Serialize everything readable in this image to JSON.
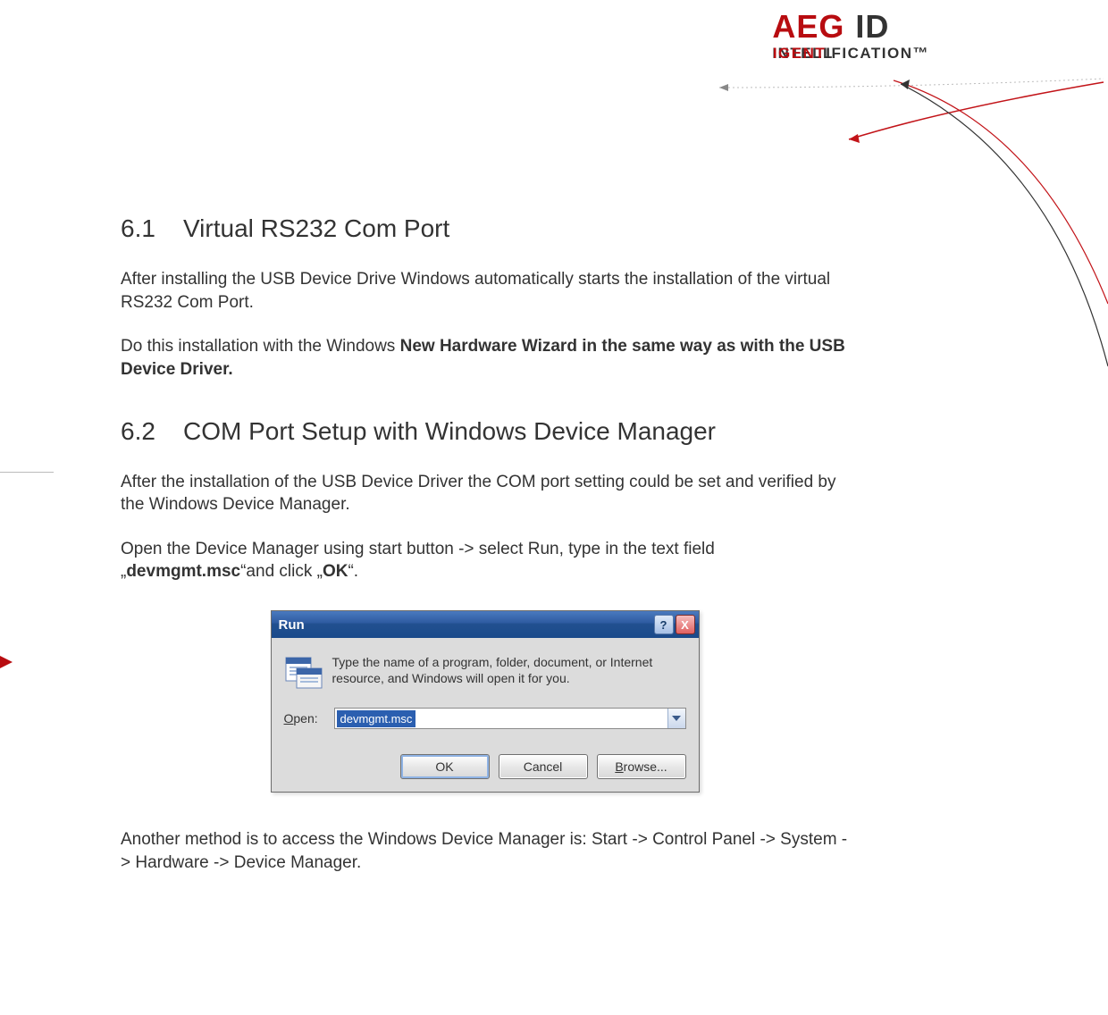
{
  "brand": {
    "logo_main": "AEG",
    "logo_sub": "ID",
    "tagline_prefix": "INTELL",
    "tagline_overlay": "IGENT",
    "tagline_rest": "IFICATION™"
  },
  "sections": {
    "s61": {
      "num": "6.1",
      "title": "Virtual RS232 Com Port",
      "p1": "After installing the USB Device Drive Windows automatically starts the installation of the virtual RS232 Com Port.",
      "p2_pre": "Do this installation with the Windows ",
      "p2_bold": "New Hardware Wizard in the same way as with the USB Device Driver."
    },
    "s62": {
      "num": "6.2",
      "title": "COM Port Setup with Windows Device Manager",
      "p1": "After the installation of the USB Device Driver the COM port setting could be set and verified by the Windows Device Manager.",
      "p2_a": "Open the Device Manager using start button -> select Run, type in the text field „",
      "p2_cmd": "devmgmt.msc",
      "p2_b": "“and click  „",
      "p2_ok": "OK",
      "p2_c": "“.",
      "p3": "Another method is to access the Windows Device Manager is: Start -> Control Panel -> System -> Hardware -> Device Manager."
    }
  },
  "run_dialog": {
    "title": "Run",
    "help_glyph": "?",
    "close_glyph": "X",
    "body_text": "Type the name of a program, folder, document, or Internet resource, and Windows will open it for you.",
    "open_label_u": "O",
    "open_label_rest": "pen:",
    "combo_value": "devmgmt.msc",
    "btn_ok": "OK",
    "btn_cancel": "Cancel",
    "btn_browse_u": "B",
    "btn_browse_rest": "rowse..."
  }
}
